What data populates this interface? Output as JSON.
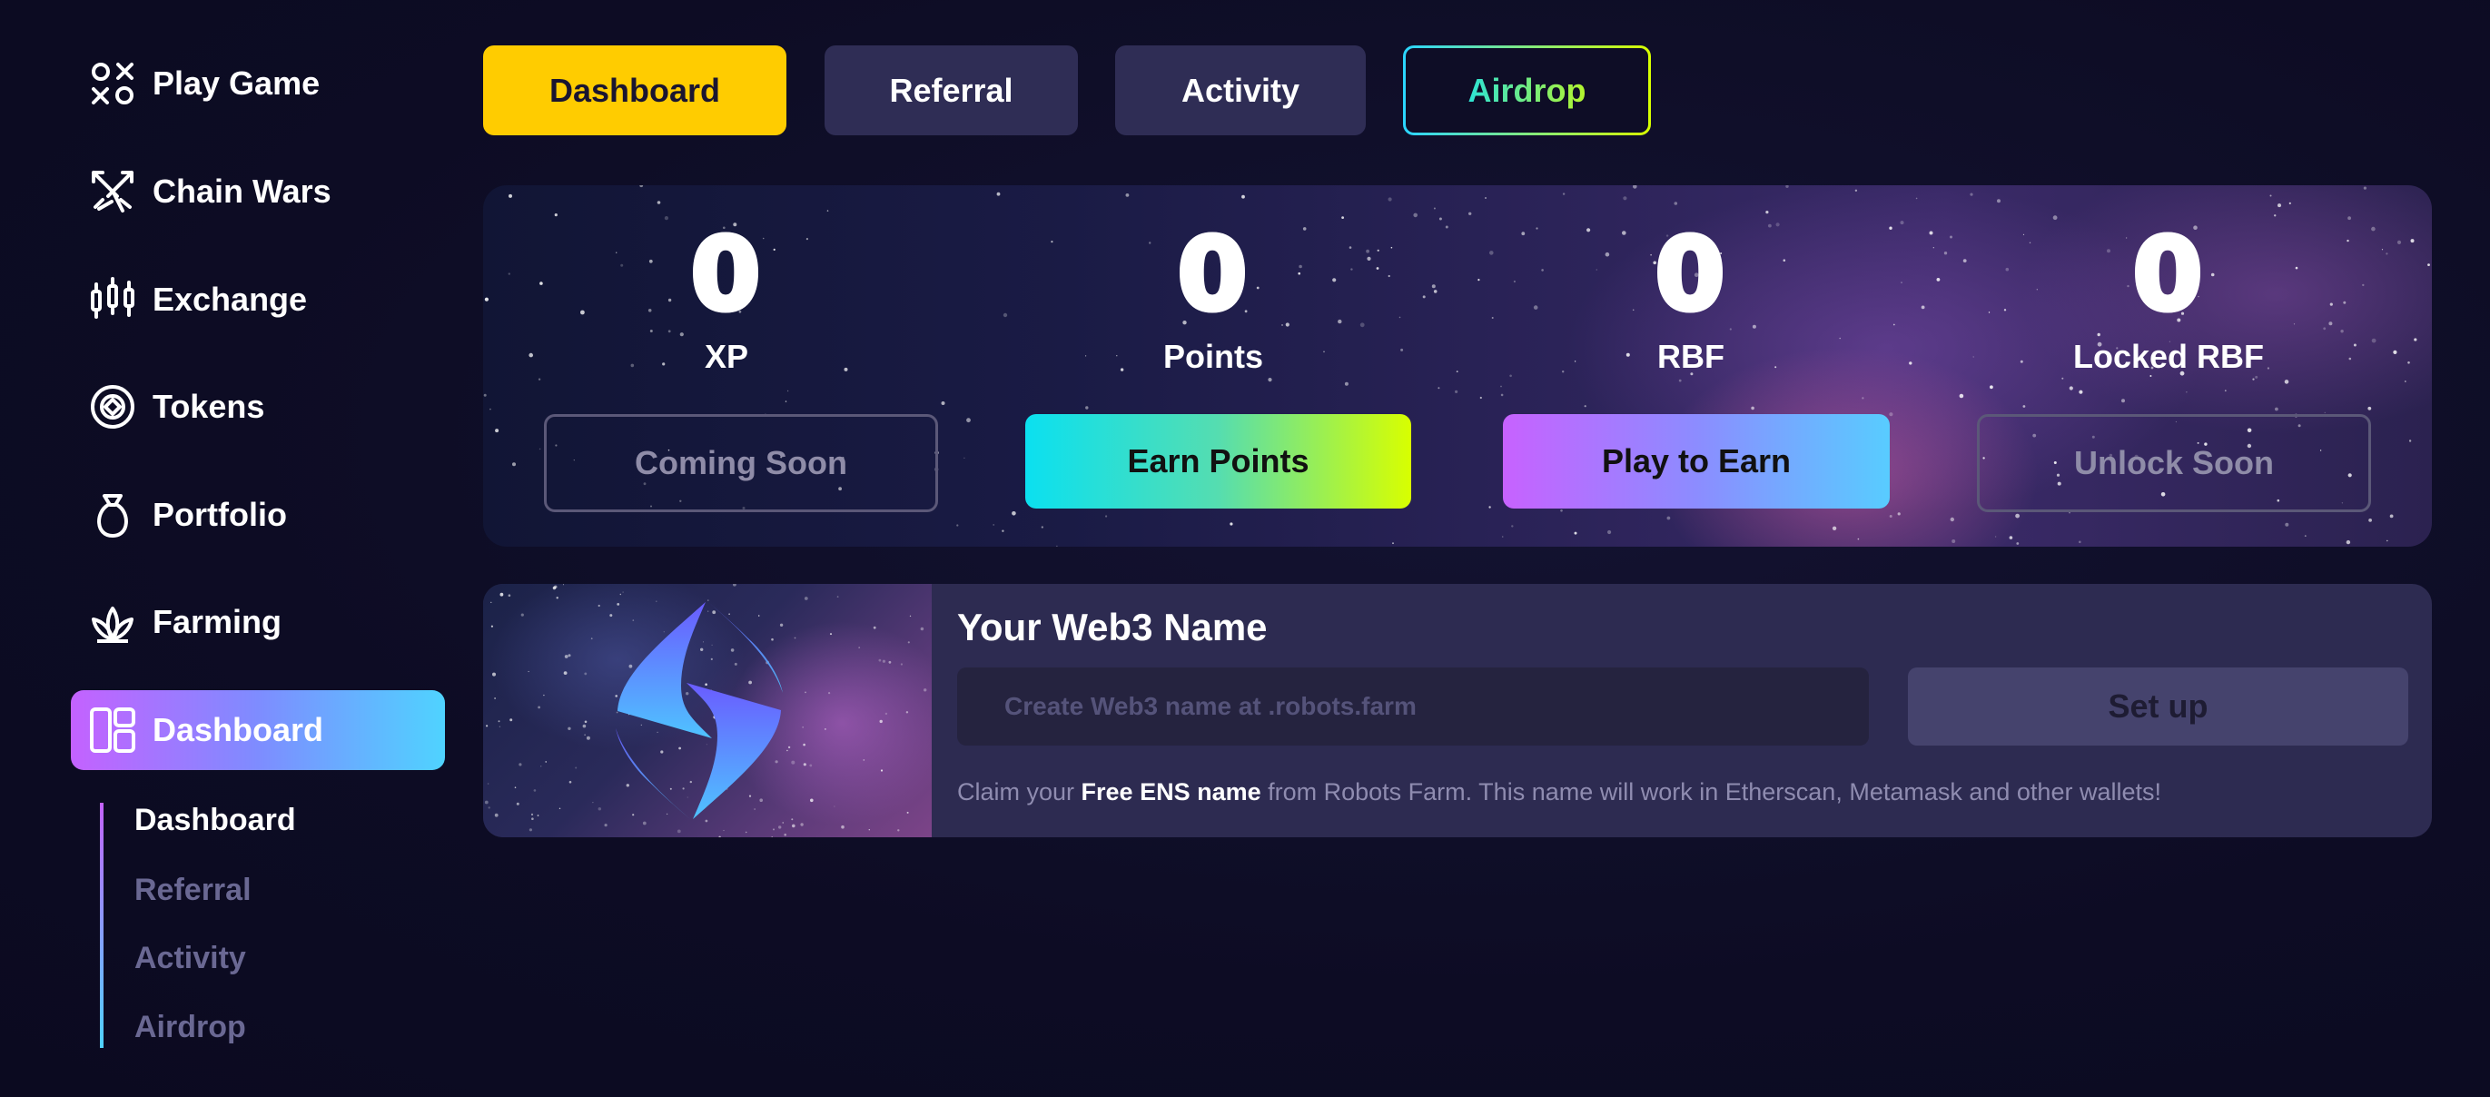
{
  "sidebar": {
    "items": [
      {
        "label": "Play Game",
        "icon": "xo-grid-icon"
      },
      {
        "label": "Chain Wars",
        "icon": "crossed-swords-icon"
      },
      {
        "label": "Exchange",
        "icon": "candlestick-icon"
      },
      {
        "label": "Tokens",
        "icon": "token-coin-icon"
      },
      {
        "label": "Portfolio",
        "icon": "money-bag-icon"
      },
      {
        "label": "Farming",
        "icon": "plant-icon"
      },
      {
        "label": "Dashboard",
        "icon": "dashboard-layout-icon",
        "active": true
      }
    ],
    "sub_items": [
      "Dashboard",
      "Referral",
      "Activity",
      "Airdrop"
    ],
    "current_sub": "Dashboard"
  },
  "tabs": {
    "dashboard": "Dashboard",
    "referral": "Referral",
    "activity": "Activity",
    "airdrop": "Airdrop"
  },
  "stats": [
    {
      "value": "0",
      "label": "XP",
      "button": "Coming Soon"
    },
    {
      "value": "0",
      "label": "Points",
      "button": "Earn Points"
    },
    {
      "value": "0",
      "label": "RBF",
      "button": "Play to Earn"
    },
    {
      "value": "0",
      "label": "Locked RBF",
      "button": "Unlock Soon"
    }
  ],
  "web3": {
    "title": "Your Web3 Name",
    "input_placeholder": "Create Web3 name at .robots.farm",
    "input_value": "",
    "setup_label": "Set up",
    "note_pre": "Claim your ",
    "note_bold": "Free ENS name",
    "note_post": " from Robots Farm. This name will work in Etherscan, Metamask and other wallets!"
  },
  "colors": {
    "accent_yellow": "#ffcc00",
    "panel": "#2d2b51",
    "background": "#0d0c24"
  }
}
